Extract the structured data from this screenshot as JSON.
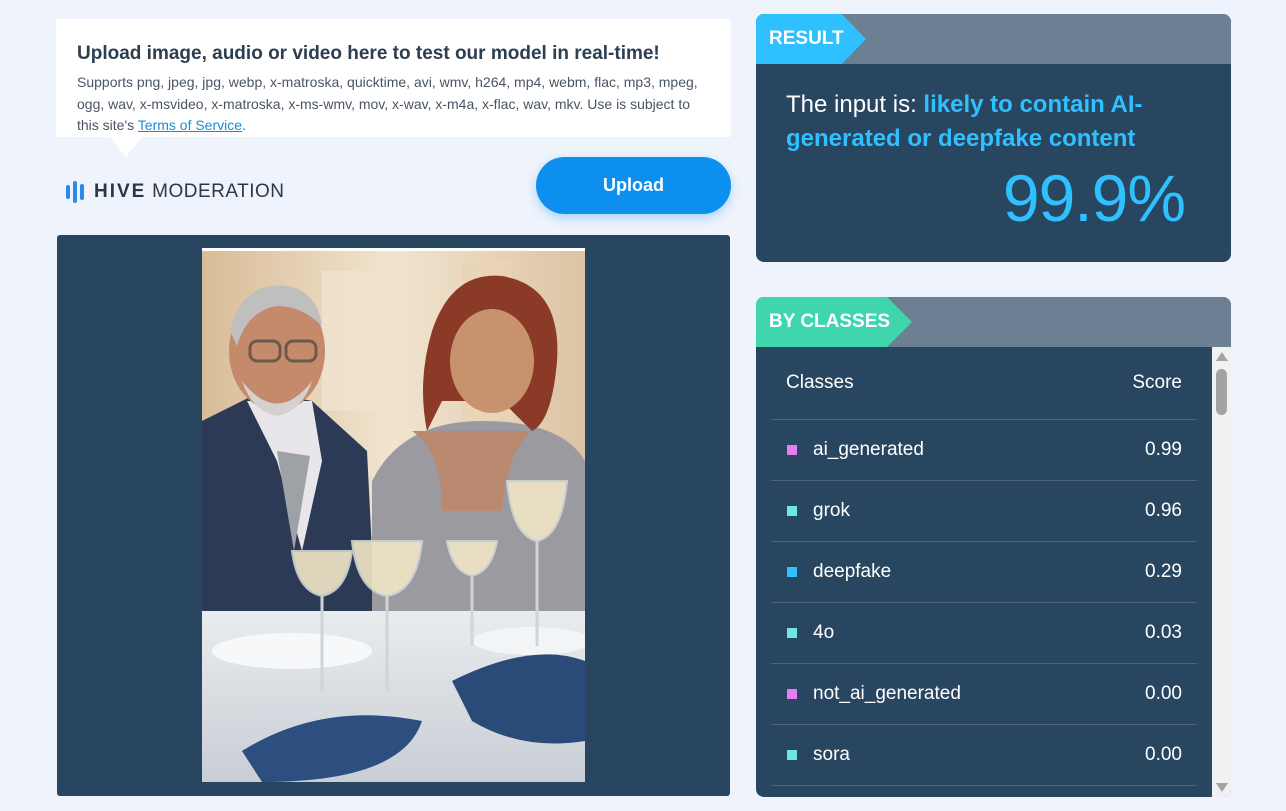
{
  "upload_info": {
    "title": "Upload image, audio or video here to test our model in real-time!",
    "description": "Supports png, jpeg, jpg, webp, x-matroska, quicktime, avi, wmv, h264, mp4, webm, flac, mp3, mpeg, ogg, wav, x-msvideo, x-matroska, x-ms-wmv, mov, x-wav, x-m4a, x-flac, wav, mkv. Use is subject to this site's ",
    "terms_link": "Terms of Service",
    "terms_suffix": "."
  },
  "brand": {
    "part1": "HIVE",
    "part2": "MODERATION"
  },
  "upload_button": "Upload",
  "preview": {
    "image": "photo of a man and a woman seated at a dinner table with wine glasses"
  },
  "result": {
    "tag": "RESULT",
    "prefix": "The input is: ",
    "verdict": "likely to contain AI-generated or deepfake content",
    "score": "99.9%"
  },
  "classes": {
    "tag": "BY CLASSES",
    "header_class": "Classes",
    "header_score": "Score",
    "rows": [
      {
        "name": "ai_generated",
        "score": "0.99",
        "color": "#e57ff0"
      },
      {
        "name": "grok",
        "score": "0.96",
        "color": "#6de8de"
      },
      {
        "name": "deepfake",
        "score": "0.29",
        "color": "#2ec0ff"
      },
      {
        "name": "4o",
        "score": "0.03",
        "color": "#6de8de"
      },
      {
        "name": "not_ai_generated",
        "score": "0.00",
        "color": "#e57ff0"
      },
      {
        "name": "sora",
        "score": "0.00",
        "color": "#6de8de"
      }
    ]
  },
  "colors": {
    "accent_blue": "#2ec0ff",
    "accent_green": "#3fd6ae",
    "panel_bg": "#294660",
    "upload_button": "#0d8ff0"
  }
}
